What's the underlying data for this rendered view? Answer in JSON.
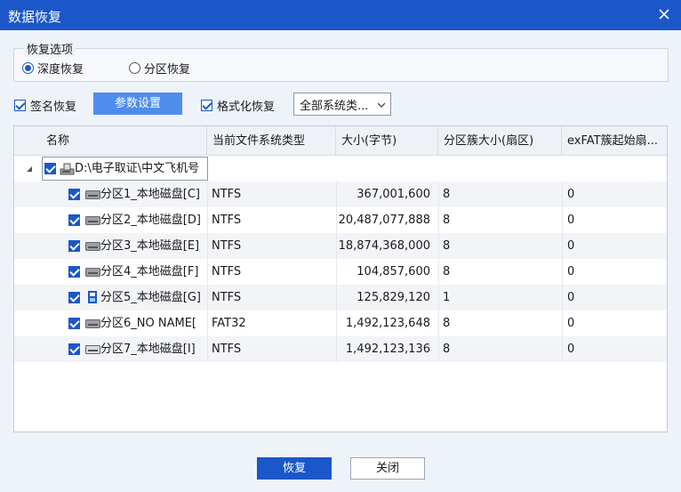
{
  "window": {
    "title": "数据恢复"
  },
  "options": {
    "legend": "恢复选项",
    "deep_recovery": "深度恢复",
    "partition_recovery": "分区恢复",
    "signature_recovery": "签名恢复",
    "param_settings": "参数设置",
    "format_recovery": "格式化恢复",
    "fs_type_selected": "全部系统类..."
  },
  "table": {
    "headers": [
      "名称",
      "当前文件系统类型",
      "大小(字节)",
      "分区簇大小(扇区)",
      "exFAT簇起始扇..."
    ],
    "root": {
      "name": "D:\\电子取证\\中文飞机号"
    },
    "rows": [
      {
        "name": "分区1_本地磁盘[C]",
        "fs": "NTFS",
        "size": "367,001,600",
        "cluster": "8",
        "exfat": "0"
      },
      {
        "name": "分区2_本地磁盘[D]",
        "fs": "NTFS",
        "size": "20,487,077,888",
        "cluster": "8",
        "exfat": "0"
      },
      {
        "name": "分区3_本地磁盘[E]",
        "fs": "NTFS",
        "size": "18,874,368,000",
        "cluster": "8",
        "exfat": "0"
      },
      {
        "name": "分区4_本地磁盘[F]",
        "fs": "NTFS",
        "size": "104,857,600",
        "cluster": "8",
        "exfat": "0"
      },
      {
        "name": "分区5_本地磁盘[G]",
        "fs": "NTFS",
        "size": "125,829,120",
        "cluster": "1",
        "exfat": "0"
      },
      {
        "name": "分区6_NO NAME[",
        "fs": "FAT32",
        "size": "1,492,123,648",
        "cluster": "8",
        "exfat": "0"
      },
      {
        "name": "分区7_本地磁盘[I]",
        "fs": "NTFS",
        "size": "1,492,123,136",
        "cluster": "8",
        "exfat": "0"
      }
    ]
  },
  "buttons": {
    "ok": "恢复",
    "close": "关闭"
  }
}
